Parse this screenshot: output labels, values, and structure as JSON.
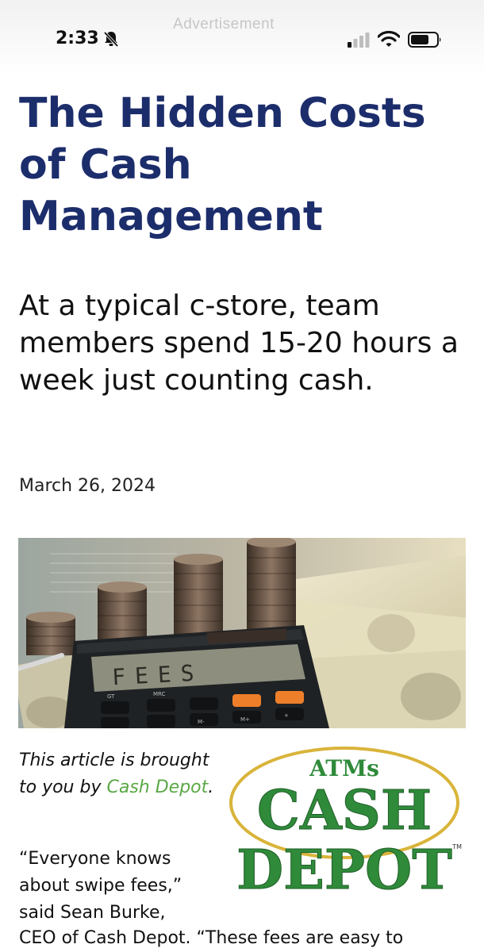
{
  "status_bar": {
    "ad_label": "Advertisement",
    "time": "2:33",
    "icons": [
      "bell-slash-icon",
      "signal-icon",
      "wifi-icon",
      "battery-icon"
    ]
  },
  "article": {
    "headline": "The Hidden Costs of Cash Management",
    "subheadline": "At a typical c-store, team members spend 15-20 hours a week just counting cash.",
    "date": "March 26, 2024",
    "hero_image_text": "FEES",
    "hero_image_labels": [
      "GT",
      "MRC",
      "M-",
      "M+",
      "%",
      "+"
    ],
    "sponsor_prefix": "This article is brought to you by",
    "sponsor_link": "Cash Depot",
    "sponsor_suffix": ".",
    "body_part1": "“Everyone knows about swipe fees,” said Sean Burke,",
    "body_part2": "CEO of Cash Depot. “These fees are easy to"
  },
  "sponsor_logo": {
    "line1": "ATMs",
    "line2": "CASH",
    "line3": "DEPOT",
    "trademark": "TM"
  },
  "colors": {
    "headline": "#1c2d6b",
    "link": "#5aa845",
    "logo_green": "#2f8a3a",
    "logo_gold": "#d9b43a"
  }
}
